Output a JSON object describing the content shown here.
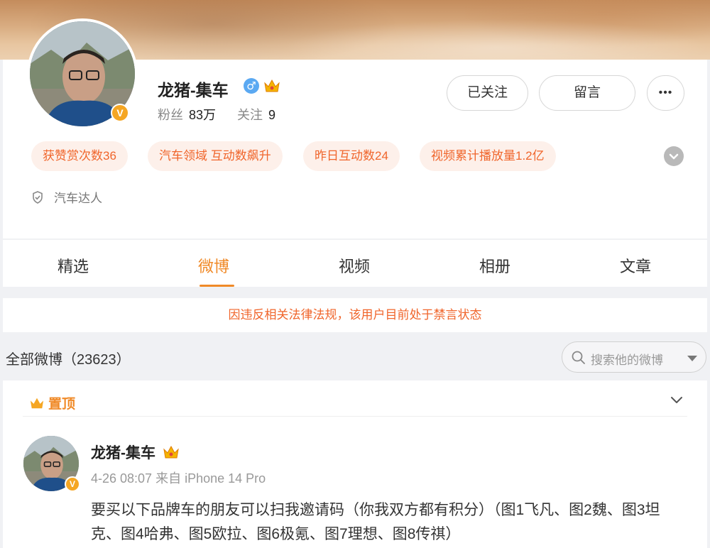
{
  "profile": {
    "name": "龙猪-集车",
    "fans_label": "粉丝",
    "fans_count": "83万",
    "following_label": "关注",
    "following_count": "9",
    "follow_button": "已关注",
    "message_button": "留言",
    "more_button": "•••",
    "verified_badge": "V",
    "tags": [
      "获赞赏次数36",
      "汽车领域 互动数飙升",
      "昨日互动数24",
      "视频累计播放量1.2亿"
    ],
    "verification": "汽车达人"
  },
  "tabs": [
    "精选",
    "微博",
    "视频",
    "相册",
    "文章"
  ],
  "active_tab": "微博",
  "notice": "因违反相关法律法规，该用户目前处于禁言状态",
  "posts_header": {
    "title": "全部微博（23623）",
    "search_placeholder": "搜索他的微博"
  },
  "post": {
    "pinned_label": "置顶",
    "author": "龙猪-集车",
    "meta": "4-26 08:07 来自 iPhone 14 Pro",
    "text": "要买以下品牌车的朋友可以扫我邀请码（你我双方都有积分）（图1飞凡、图2魏、图3坦克、图4哈弗、图5欧拉、图6极氪、图7理想、图8传祺）"
  },
  "colors": {
    "accent": "#f08a28",
    "tag_text": "#f0652b",
    "tag_bg": "#fdf0ea",
    "verified": "#f5a623",
    "gender": "#5ba9f2"
  },
  "icons": {
    "gender": "male-icon",
    "crown": "crown-icon",
    "shield": "shield-icon",
    "search": "search-icon",
    "chevron": "chevron-down-icon"
  }
}
